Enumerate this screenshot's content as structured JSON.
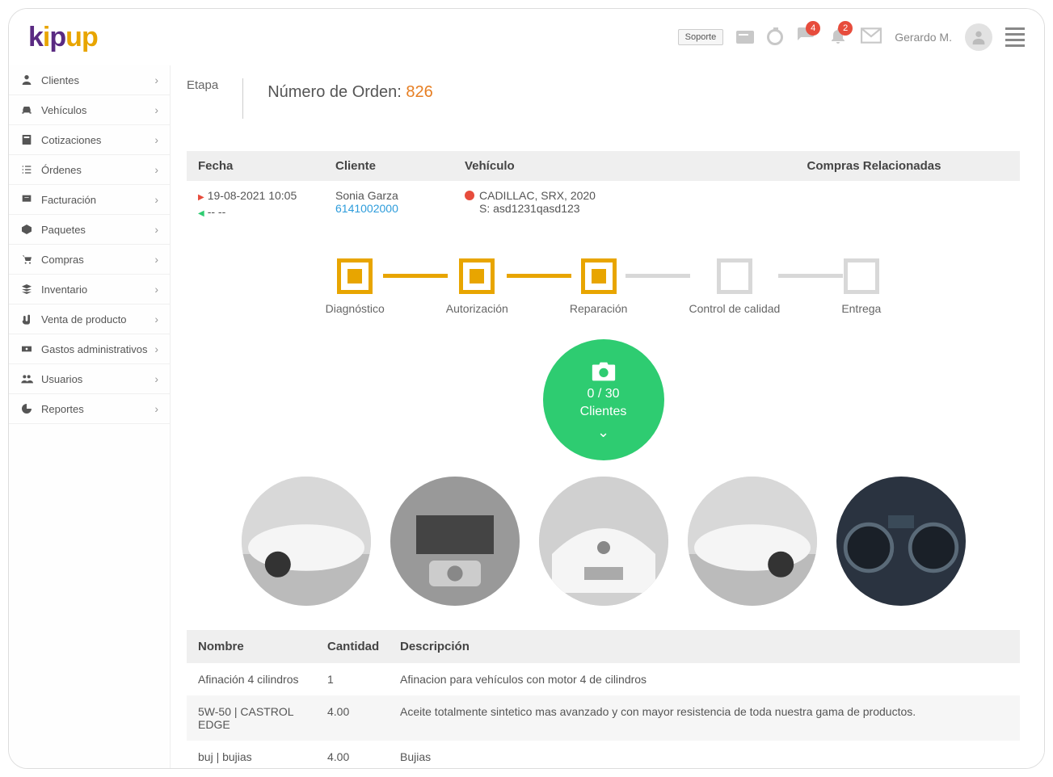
{
  "header": {
    "soporte": "Soporte",
    "username": "Gerardo M.",
    "badge_comments": "4",
    "badge_bell": "2"
  },
  "sidebar": {
    "items": [
      {
        "label": "Clientes"
      },
      {
        "label": "Vehículos"
      },
      {
        "label": "Cotizaciones"
      },
      {
        "label": "Órdenes"
      },
      {
        "label": "Facturación"
      },
      {
        "label": "Paquetes"
      },
      {
        "label": "Compras"
      },
      {
        "label": "Inventario"
      },
      {
        "label": "Venta de producto"
      },
      {
        "label": "Gastos administrativos"
      },
      {
        "label": "Usuarios"
      },
      {
        "label": "Reportes"
      }
    ]
  },
  "order": {
    "etapa_label": "Etapa",
    "order_label": "Número de Orden: ",
    "order_number": "826"
  },
  "info": {
    "headers": {
      "fecha": "Fecha",
      "cliente": "Cliente",
      "vehiculo": "Vehículo",
      "compras": "Compras Relacionadas"
    },
    "fecha": {
      "in": "19-08-2021 10:05",
      "out": "-- --"
    },
    "cliente": {
      "name": "Sonia Garza",
      "phone": "6141002000"
    },
    "vehiculo": {
      "line1": "CADILLAC, SRX, 2020",
      "line2": "S: asd1231qasd123"
    }
  },
  "steps": [
    {
      "label": "Diagnóstico",
      "active": true
    },
    {
      "label": "Autorización",
      "active": true
    },
    {
      "label": "Reparación",
      "active": true
    },
    {
      "label": "Control de calidad",
      "active": false
    },
    {
      "label": "Entrega",
      "active": false
    }
  ],
  "photos": {
    "count": "0 / 30",
    "label": "Clientes"
  },
  "table": {
    "headers": {
      "nombre": "Nombre",
      "cantidad": "Cantidad",
      "descripcion": "Descripción"
    },
    "rows": [
      {
        "nombre": "Afinación 4 cilindros",
        "cantidad": "1",
        "descripcion": "Afinacion para vehículos con motor 4 de cilindros"
      },
      {
        "nombre": "5W-50 | CASTROL EDGE",
        "cantidad": "4.00",
        "descripcion": "Aceite totalmente sintetico mas avanzado y con mayor resistencia de toda nuestra gama de productos."
      },
      {
        "nombre": "buj | bujias",
        "cantidad": "4.00",
        "descripcion": "Bujias"
      }
    ]
  }
}
